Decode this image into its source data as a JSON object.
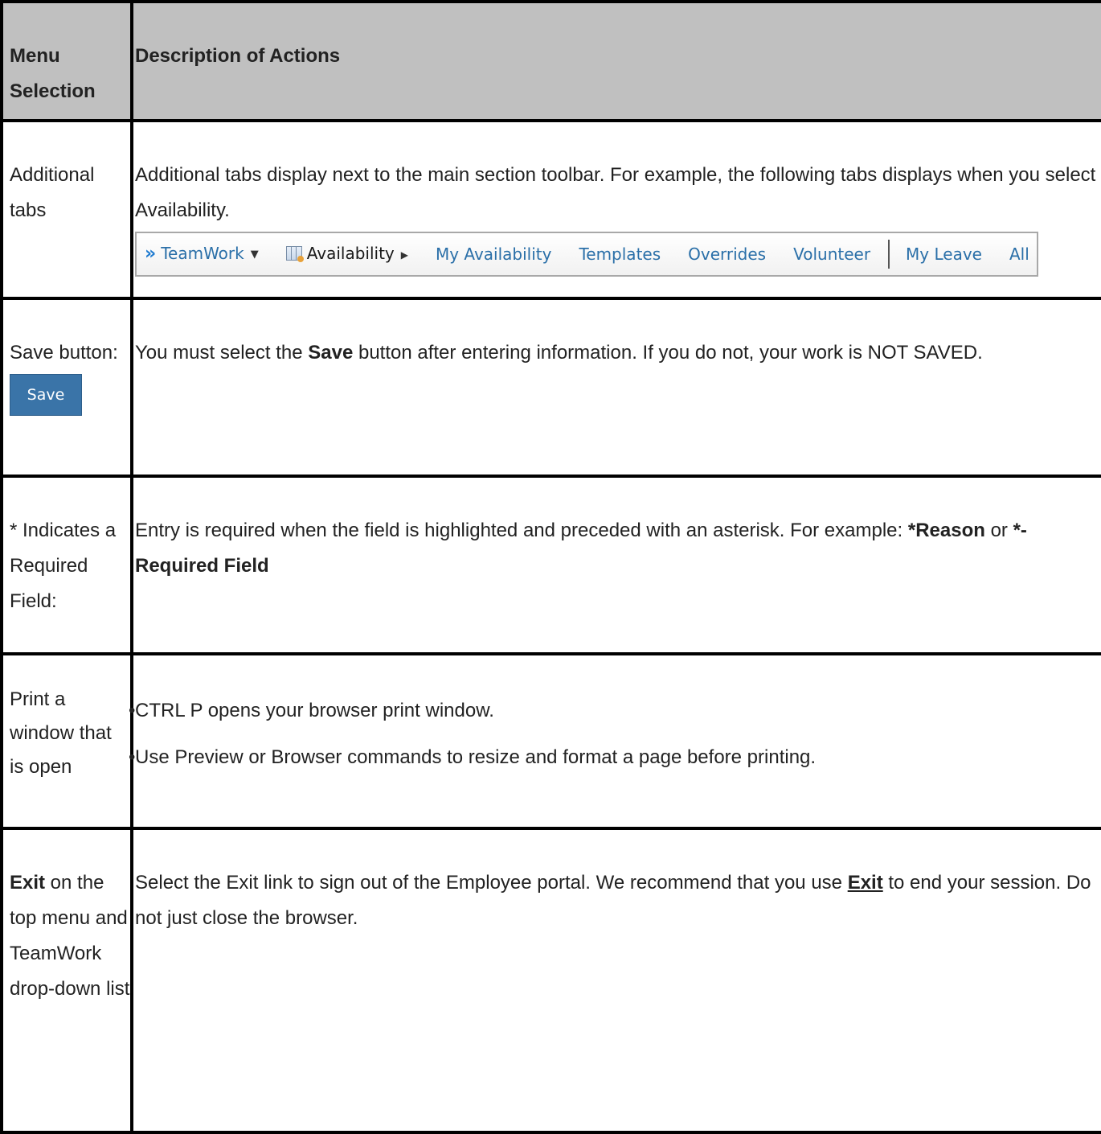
{
  "header": {
    "col1": "Menu Selection",
    "col2": "Description of Actions"
  },
  "rows": {
    "tabs": {
      "label": "Additional tabs",
      "desc": "Additional tabs display next to the main section toolbar. For example, the following tabs displays when you select Availability.",
      "toolbar": {
        "teamwork": "TeamWork",
        "availability": "Availability",
        "my_availability": "My Availability",
        "templates": "Templates",
        "overrides": "Overrides",
        "volunteer": "Volunteer",
        "my_leave": "My Leave",
        "all": "All"
      }
    },
    "save": {
      "label": "Save button:",
      "button": "Save",
      "desc_1": "You must select the ",
      "desc_bold": "Save",
      "desc_2": " button after entering information. If you do not, your work is NOT SAVED."
    },
    "required": {
      "label": "* Indicates a Required Field:",
      "desc_1": "Entry is required when the field is highlighted and preceded with an asterisk. For example: ",
      "bold_1": "*Reason",
      "desc_2": " or ",
      "bold_2": "*-Required Field"
    },
    "print": {
      "label": "Print a window that is open",
      "bullet_1": "CTRL P opens your browser print window.",
      "bullet_2": "Use Preview or Browser commands to resize and format a page before printing."
    },
    "exit": {
      "label_bold": "Exit",
      "label_rest": " on the top menu and TeamWork drop-down list",
      "desc_1": "Select the Exit link to sign out of the Employee portal. We recommend that you use ",
      "link": "Exit",
      "desc_2": " to end your session. Do not just close the browser."
    }
  },
  "colors": {
    "header_bg": "#c0c0c0",
    "save_button_bg": "#3a74a8",
    "tab_link": "#2a6fa8"
  }
}
